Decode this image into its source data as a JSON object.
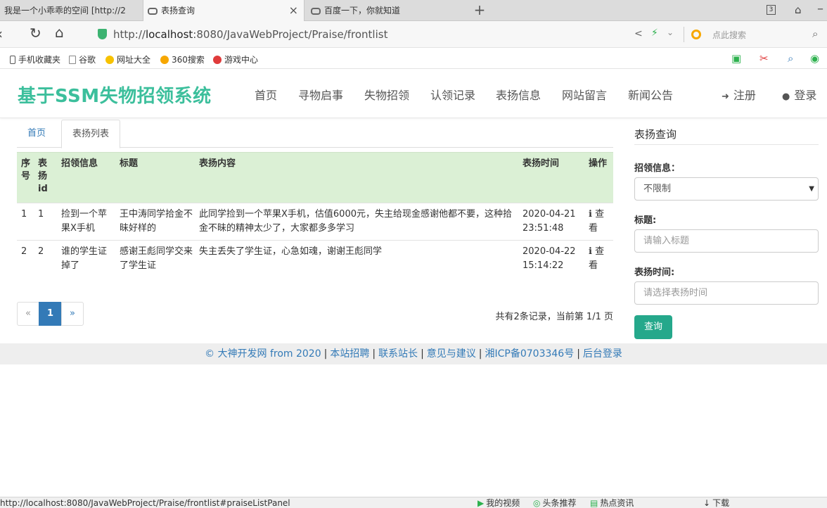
{
  "browser": {
    "tabs": [
      {
        "label": "我是一个小乖乖的空间 [http://2"
      },
      {
        "label": "表扬查询"
      },
      {
        "label": "百度一下，你就知道"
      }
    ],
    "tab_close": "×",
    "new_tab": "+",
    "tab_count": "3",
    "url_prefix": "http://",
    "url_host": "localhost",
    "url_rest": ":8080/JavaWebProject/Praise/frontlist",
    "search_placeholder": "点此搜索",
    "bookmarks": [
      "手机收藏夹",
      "谷歌",
      "网址大全",
      "360搜索",
      "游戏中心"
    ],
    "status_url": "http://localhost:8080/JavaWebProject/Praise/frontlist#praiseListPanel",
    "status_items": [
      "我的视频",
      "头条推荐",
      "热点资讯",
      "下载"
    ]
  },
  "site": {
    "brand": "基于SSM失物招领系统",
    "nav": [
      "首页",
      "寻物启事",
      "失物招领",
      "认领记录",
      "表扬信息",
      "网站留言",
      "新闻公告"
    ],
    "register": "注册",
    "login": "登录"
  },
  "content_tabs": {
    "home": "首页",
    "list": "表扬列表"
  },
  "table": {
    "headers": {
      "seq": "序号",
      "id": "表扬id",
      "claim": "招领信息",
      "title": "标题",
      "content": "表扬内容",
      "time": "表扬时间",
      "op": "操作"
    },
    "rows": [
      {
        "seq": "1",
        "id": "1",
        "claim": "捡到一个苹果X手机",
        "title": "王中涛同学拾金不昧好样的",
        "content": "此同学捡到一个苹果X手机，估值6000元，失主给现金感谢他都不要，这种拾金不昧的精神太少了，大家都多多学习",
        "time": "2020-04-21 23:51:48",
        "op": "ℹ 查看"
      },
      {
        "seq": "2",
        "id": "2",
        "claim": "谁的学生证掉了",
        "title": "感谢王彪同学交来了学生证",
        "content": "失主丢失了学生证，心急如魂，谢谢王彪同学",
        "time": "2020-04-22 15:14:22",
        "op": "ℹ 查看"
      }
    ]
  },
  "pagination": {
    "prev": "«",
    "current": "1",
    "next": "»",
    "info": "共有2条记录，当前第 1/1 页"
  },
  "search_panel": {
    "title": "表扬查询",
    "claim_label": "招领信息：",
    "claim_value": "不限制",
    "title_label": "标题:",
    "title_placeholder": "请输入标题",
    "time_label": "表扬时间:",
    "time_placeholder": "请选择表扬时间",
    "query_button": "查询"
  },
  "footer": {
    "links": [
      "© 大神开发网 from 2020",
      "本站招聘",
      "联系站长",
      "意见与建议",
      "湘ICP备0703346号",
      "后台登录"
    ]
  },
  "colors": {
    "brand": "#3cbf9c",
    "primary": "#337ab7",
    "query_button": "#25a88b",
    "table_header": "#dbf0d5"
  }
}
